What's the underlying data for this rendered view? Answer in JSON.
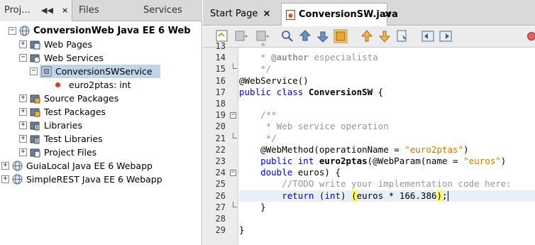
{
  "left_tabs": {
    "projects": "Proj...",
    "files": "Files",
    "services": "Services"
  },
  "tree": [
    {
      "label": "ConversionWeb Java EE 6 Web",
      "expander": "−",
      "icon": "globe-icon"
    },
    {
      "label": "Web Pages",
      "expander": "+",
      "icon": "web-pages-folder-icon"
    },
    {
      "label": "Web Services",
      "expander": "−",
      "icon": "web-services-folder-icon"
    },
    {
      "label": "ConversionSWService",
      "expander": "−",
      "icon": "web-service-icon"
    },
    {
      "label": "euro2ptas: int",
      "expander": "",
      "icon": "operation-dot-icon"
    },
    {
      "label": "Source Packages",
      "expander": "+",
      "icon": "package-folder-icon"
    },
    {
      "label": "Test Packages",
      "expander": "+",
      "icon": "package-folder-icon"
    },
    {
      "label": "Libraries",
      "expander": "+",
      "icon": "library-folder-icon"
    },
    {
      "label": "Test Libraries",
      "expander": "+",
      "icon": "library-folder-icon"
    },
    {
      "label": "Project Files",
      "expander": "+",
      "icon": "project-files-folder-icon"
    },
    {
      "label": "GuiaLocal Java EE 6 Webapp",
      "expander": "+",
      "icon": "globe-icon"
    },
    {
      "label": "SimpleREST Java EE 6 Webapp",
      "expander": "+",
      "icon": "globe-icon"
    }
  ],
  "editor_tabs": {
    "start_page": "Start Page",
    "file": "ConversionSW.java"
  },
  "gutter": {
    "line_numbers": [
      "13",
      "14",
      "15",
      "16",
      "17",
      "18",
      "19",
      "20",
      "21",
      "22",
      "23",
      "24",
      "25",
      "26",
      "27",
      "28",
      "29"
    ],
    "fold_markers": {
      "15": "└",
      "19": "−",
      "21": "└",
      "24": "−",
      "27": "└"
    }
  },
  "code_lines": [
    [
      {
        "t": "    *",
        "c": "c"
      }
    ],
    [
      {
        "t": "    * ",
        "c": "c"
      },
      {
        "t": "@author",
        "c": "cb"
      },
      {
        "t": " especialista",
        "c": "c"
      }
    ],
    [
      {
        "t": "    */",
        "c": "c"
      }
    ],
    [
      {
        "t": "@WebService()",
        "c": ""
      }
    ],
    [
      {
        "t": "public class ",
        "c": "k"
      },
      {
        "t": "ConversionSW",
        "c": "b"
      },
      {
        "t": " {",
        "c": ""
      }
    ],
    [
      {
        "t": "",
        "c": ""
      }
    ],
    [
      {
        "t": "    /**",
        "c": "c"
      }
    ],
    [
      {
        "t": "     * Web service operation",
        "c": "c"
      }
    ],
    [
      {
        "t": "     */",
        "c": "c"
      }
    ],
    [
      {
        "t": "    @WebMethod(operationName = ",
        "c": ""
      },
      {
        "t": "\"euro2ptas\"",
        "c": "s"
      },
      {
        "t": ")",
        "c": ""
      }
    ],
    [
      {
        "t": "    public int ",
        "c": "k"
      },
      {
        "t": "euro2ptas",
        "c": "b"
      },
      {
        "t": "(@WebParam(name = ",
        "c": ""
      },
      {
        "t": "\"euros\"",
        "c": "s"
      },
      {
        "t": ")",
        "c": ""
      }
    ],
    [
      {
        "t": "    double",
        "c": "k"
      },
      {
        "t": " euros) {",
        "c": ""
      }
    ],
    [
      {
        "t": "        //TODO write your implementation code here:",
        "c": "c"
      }
    ],
    [
      {
        "t": "        ",
        "c": ""
      },
      {
        "t": "return",
        "c": "k"
      },
      {
        "t": " (",
        "c": ""
      },
      {
        "t": "int",
        "c": "k"
      },
      {
        "t": ") ",
        "c": ""
      },
      {
        "t": "(",
        "c": "hl"
      },
      {
        "t": "euros * 166.386",
        "c": ""
      },
      {
        "t": ")",
        "c": "hl"
      },
      {
        "t": ";",
        "c": ""
      }
    ],
    [
      {
        "t": "    }",
        "c": ""
      }
    ],
    [
      {
        "t": "",
        "c": ""
      }
    ],
    [
      {
        "t": "}",
        "c": ""
      }
    ]
  ],
  "current_line_index": 13,
  "colors": {
    "keyword": "#0000e6",
    "string": "#ce7b00",
    "comment": "#969696",
    "selection": "#bdd5e9",
    "bracket_highlight": "#ffff55",
    "current_line": "#e9eff8"
  },
  "toolbar_icons": [
    "source-history-icon",
    "back-icon",
    "forward-icon",
    "find-icon",
    "find-previous-icon",
    "find-next-icon",
    "toggle-highlight-icon",
    "previous-bookmark-icon",
    "next-bookmark-icon",
    "toggle-bookmark-icon",
    "shift-left-icon",
    "shift-right-icon",
    "record-macro-icon"
  ]
}
